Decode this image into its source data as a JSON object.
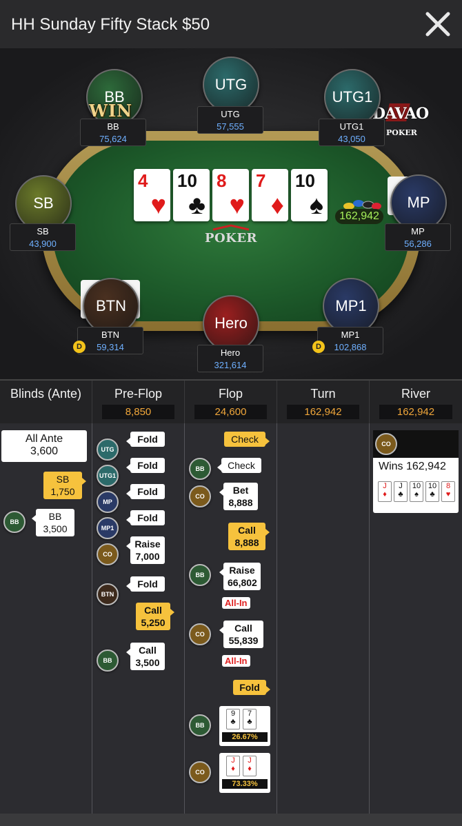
{
  "header": {
    "title": "HH Sunday Fifty Stack $50",
    "close_icon": "close-icon"
  },
  "brand": {
    "name": "DAVAO",
    "sub": "POKER"
  },
  "felt_logo": "POKER",
  "win_badge": "WIN",
  "seats": [
    {
      "id": "bb",
      "avatar": "BB",
      "name": "BB",
      "stack": "75,624",
      "color": "#2d6a3a"
    },
    {
      "id": "utg",
      "avatar": "UTG",
      "name": "UTG",
      "stack": "57,555",
      "color": "#2c6a6a"
    },
    {
      "id": "utg1",
      "avatar": "UTG1",
      "name": "UTG1",
      "stack": "43,050",
      "color": "#2c6a6a"
    },
    {
      "id": "sb",
      "avatar": "SB",
      "name": "SB",
      "stack": "43,900",
      "color": "#6b7a2a"
    },
    {
      "id": "mp",
      "avatar": "MP",
      "name": "MP",
      "stack": "56,286",
      "color": "#2a3a66"
    },
    {
      "id": "btn",
      "avatar": "BTN",
      "name": "BTN",
      "stack": "59,314",
      "color": "#4a3020"
    },
    {
      "id": "hero",
      "avatar": "Hero",
      "name": "Hero",
      "stack": "321,614",
      "color": "#9a1f1f"
    },
    {
      "id": "mp1",
      "avatar": "MP1",
      "name": "MP1",
      "stack": "102,868",
      "color": "#2a3a66"
    }
  ],
  "dealer_button": "D",
  "board": [
    {
      "rank": "4",
      "suit": "♥",
      "color": "red"
    },
    {
      "rank": "10",
      "suit": "♣",
      "color": "black"
    },
    {
      "rank": "8",
      "suit": "♥",
      "color": "red"
    },
    {
      "rank": "7",
      "suit": "♦",
      "color": "red"
    },
    {
      "rank": "10",
      "suit": "♠",
      "color": "black"
    }
  ],
  "main_pot": "162,942",
  "streets": [
    {
      "label": "Blinds (Ante)",
      "pot": ""
    },
    {
      "label": "Pre-Flop",
      "pot": "8,850"
    },
    {
      "label": "Flop",
      "pot": "24,600"
    },
    {
      "label": "Turn",
      "pot": "162,942"
    },
    {
      "label": "River",
      "pot": "162,942"
    }
  ],
  "blinds": {
    "ante_label": "All Ante",
    "ante_amount": "3,600",
    "sb_label": "SB",
    "sb_amount": "1,750",
    "bb_chip": "BB",
    "bb_label": "BB",
    "bb_amount": "3,500"
  },
  "preflop": [
    {
      "chip": "UTG",
      "action": "Fold",
      "amount": ""
    },
    {
      "chip": "UTG1",
      "action": "Fold",
      "amount": ""
    },
    {
      "chip": "MP",
      "action": "Fold",
      "amount": ""
    },
    {
      "chip": "MP1",
      "action": "Fold",
      "amount": ""
    },
    {
      "chip": "CO",
      "action": "Raise",
      "amount": "7,000"
    },
    {
      "chip": "BTN",
      "action": "Fold",
      "amount": ""
    },
    {
      "chip": "",
      "action": "Call",
      "amount": "5,250"
    },
    {
      "chip": "BB",
      "action": "Call",
      "amount": "3,500"
    }
  ],
  "flop": {
    "check_hero": "Check",
    "bb_check": "Check",
    "co_bet": "Bet",
    "co_bet_amt": "8,888",
    "hero_call": "Call",
    "hero_call_amt": "8,888",
    "bb_raise": "Raise",
    "bb_raise_amt": "66,802",
    "all_in": "All-In",
    "co_call": "Call",
    "co_call_amt": "55,839",
    "hero_fold": "Fold",
    "bb_show": [
      {
        "rank": "9",
        "suit": "♣"
      },
      {
        "rank": "7",
        "suit": "♣"
      }
    ],
    "bb_equity": "26.67%",
    "co_show": [
      {
        "rank": "J",
        "suit": "♦"
      },
      {
        "rank": "J",
        "suit": "♦"
      }
    ],
    "co_equity": "73.33%"
  },
  "river": {
    "winner_chip": "CO",
    "wins_text": "Wins 162,942",
    "cards": [
      {
        "rank": "J",
        "suit": "♦",
        "color": "red"
      },
      {
        "rank": "J",
        "suit": "♣",
        "color": "black"
      },
      {
        "rank": "10",
        "suit": "♠",
        "color": "black"
      },
      {
        "rank": "10",
        "suit": "♣",
        "color": "black"
      },
      {
        "rank": "8",
        "suit": "♥",
        "color": "red"
      }
    ]
  }
}
